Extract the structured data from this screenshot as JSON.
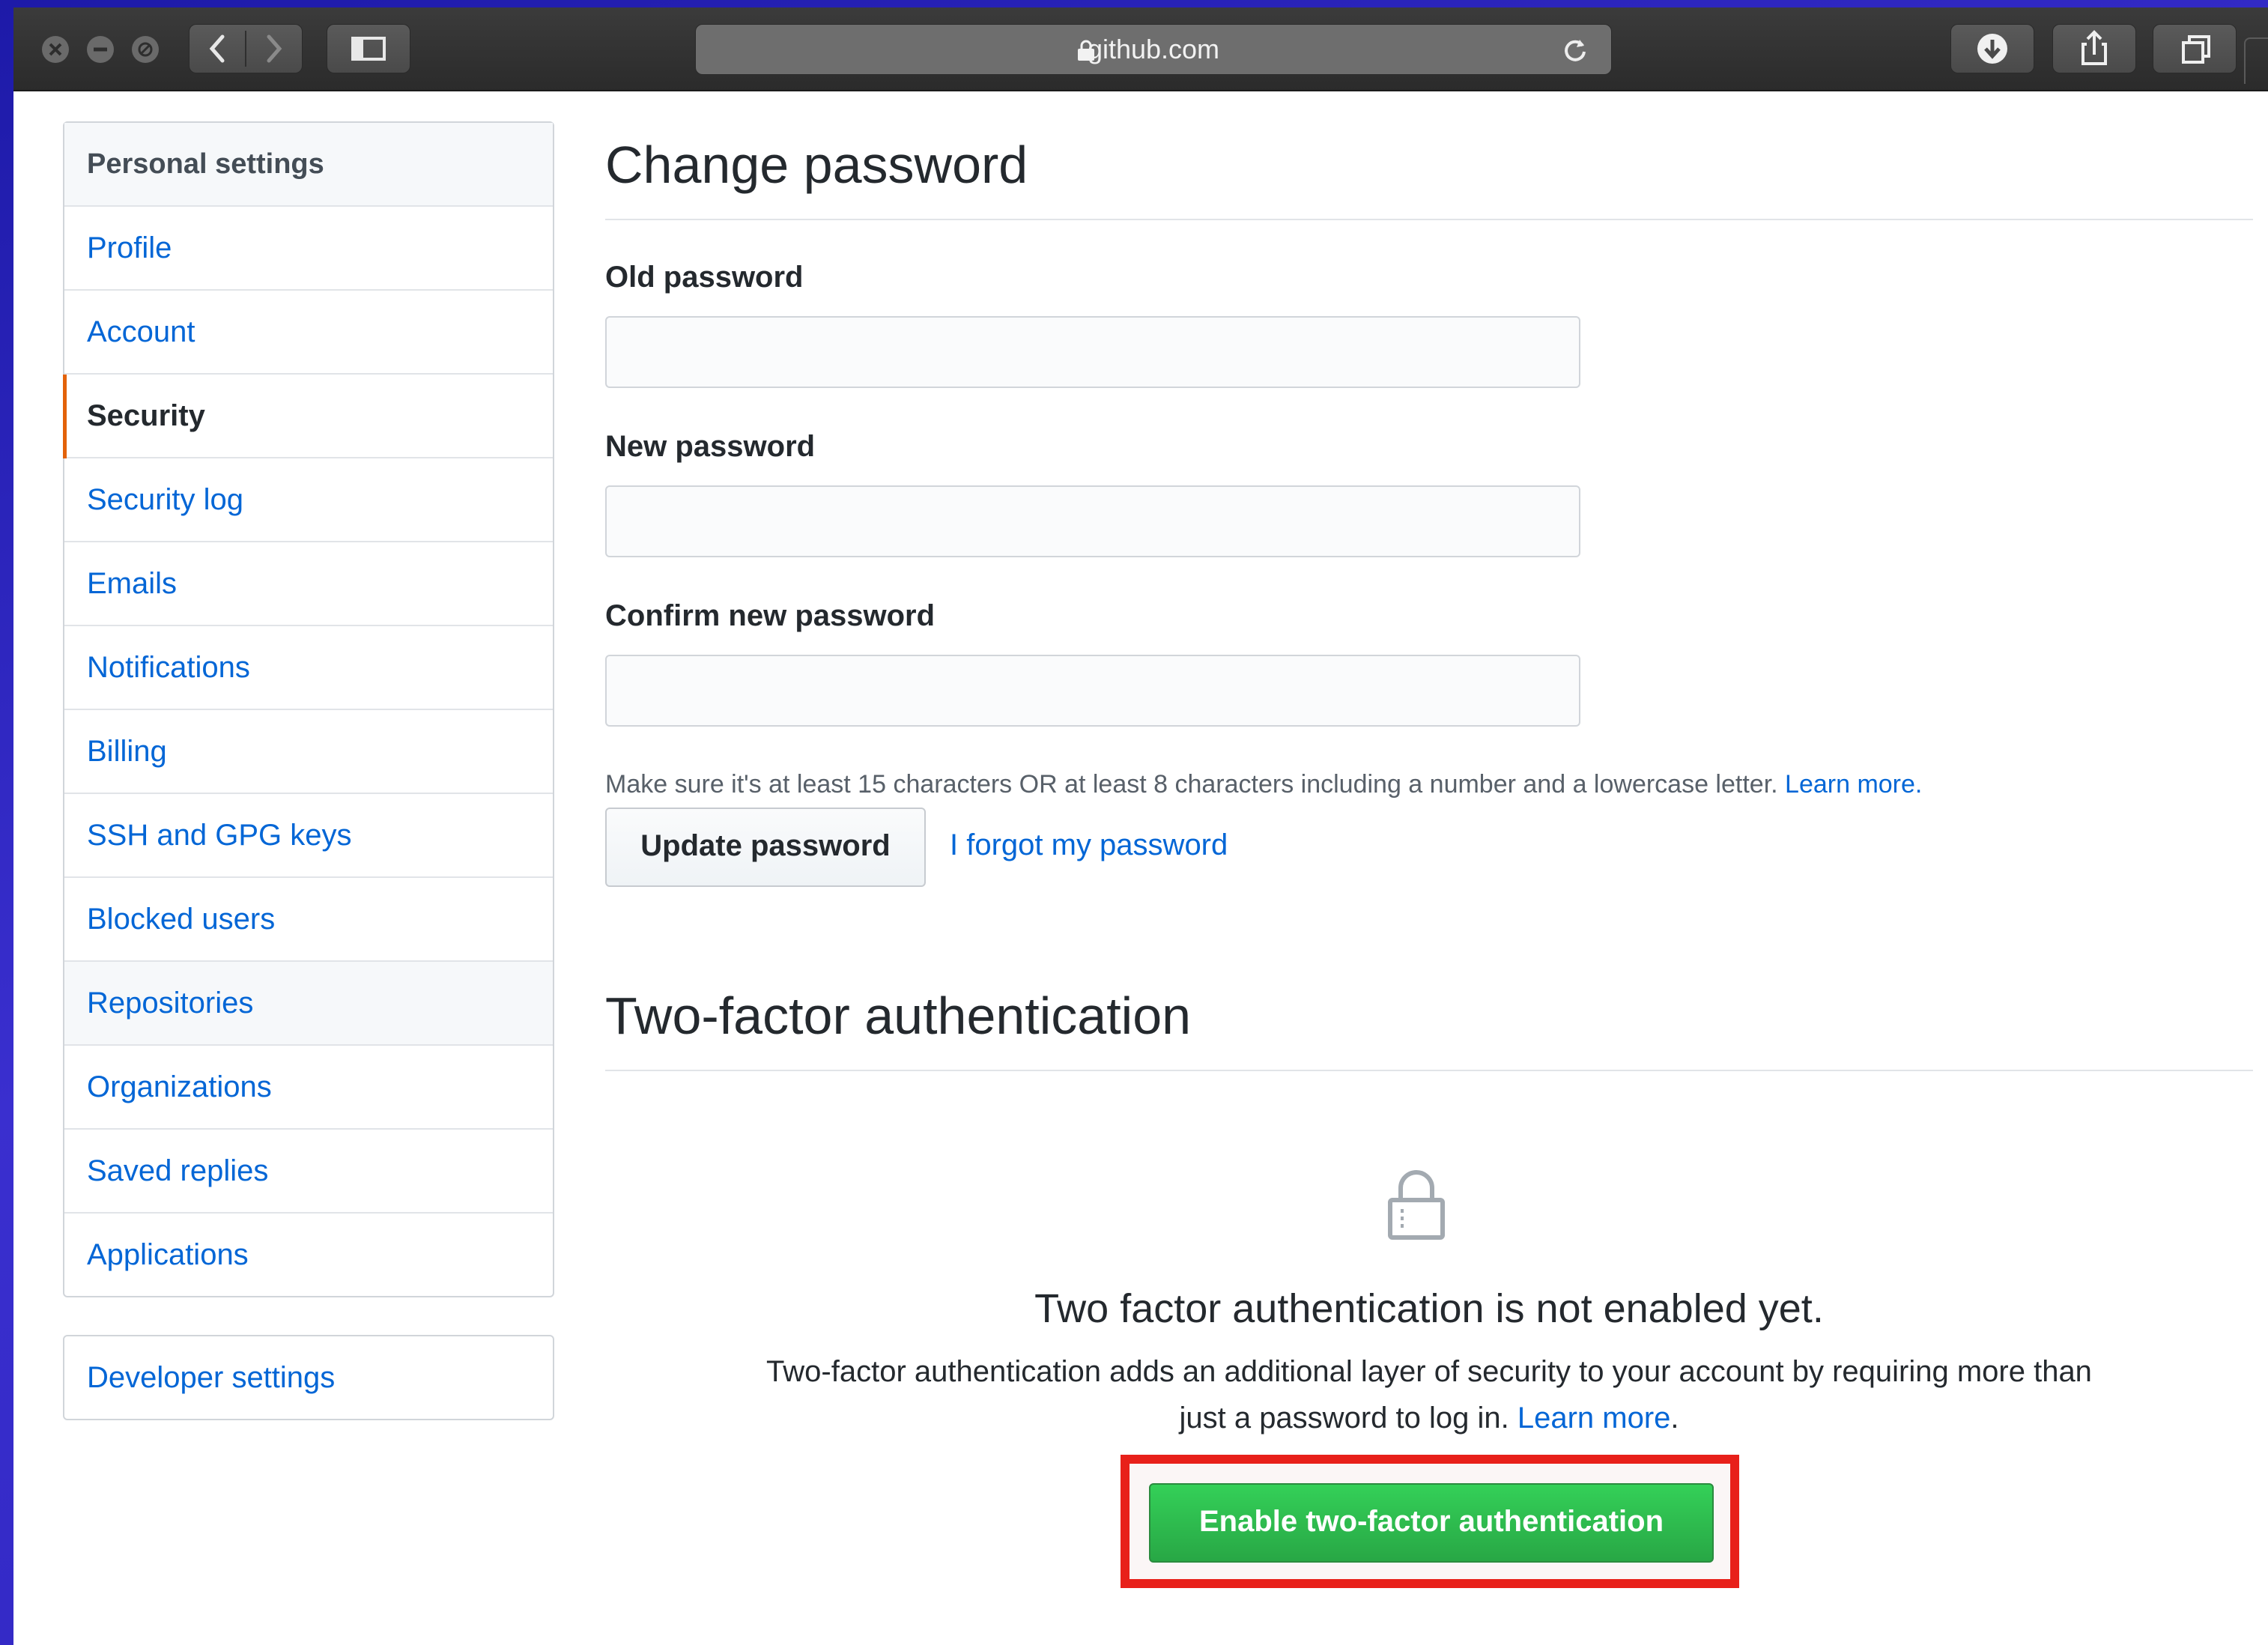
{
  "browser": {
    "url": "github.com",
    "controls": [
      "close-icon",
      "minimize-icon",
      "fullscreen-icon",
      "back-icon",
      "forward-icon",
      "sidebar-toggle-icon",
      "lock-icon",
      "reload-icon",
      "download-icon",
      "share-icon",
      "tabs-icon"
    ]
  },
  "sidebar": {
    "heading": "Personal settings",
    "items": [
      {
        "label": "Profile"
      },
      {
        "label": "Account"
      },
      {
        "label": "Security",
        "selected": true
      },
      {
        "label": "Security log"
      },
      {
        "label": "Emails"
      },
      {
        "label": "Notifications"
      },
      {
        "label": "Billing"
      },
      {
        "label": "SSH and GPG keys"
      },
      {
        "label": "Blocked users"
      },
      {
        "label": "Repositories"
      },
      {
        "label": "Organizations"
      },
      {
        "label": "Saved replies"
      },
      {
        "label": "Applications"
      }
    ],
    "developer": "Developer settings"
  },
  "password": {
    "title": "Change password",
    "old_label": "Old password",
    "new_label": "New password",
    "confirm_label": "Confirm new password",
    "hint": "Make sure it's at least 15 characters OR at least 8 characters including a number and a lowercase letter.",
    "hint_link": "Learn more.",
    "update_button": "Update password",
    "forgot_link": "I forgot my password"
  },
  "tfa": {
    "title": "Two-factor authentication",
    "heading": "Two factor authentication is not enabled yet.",
    "desc_line1": "Two-factor authentication adds an additional layer of security to your account by requiring more than",
    "desc_line2": "just a password to log in.",
    "desc_link": "Learn more",
    "desc_end": ".",
    "enable_button": "Enable two-factor authentication"
  },
  "colors": {
    "link": "#0366d6",
    "selected_marker": "#e36209",
    "enable_green": "#28a745",
    "highlight_red": "#e8201a"
  }
}
